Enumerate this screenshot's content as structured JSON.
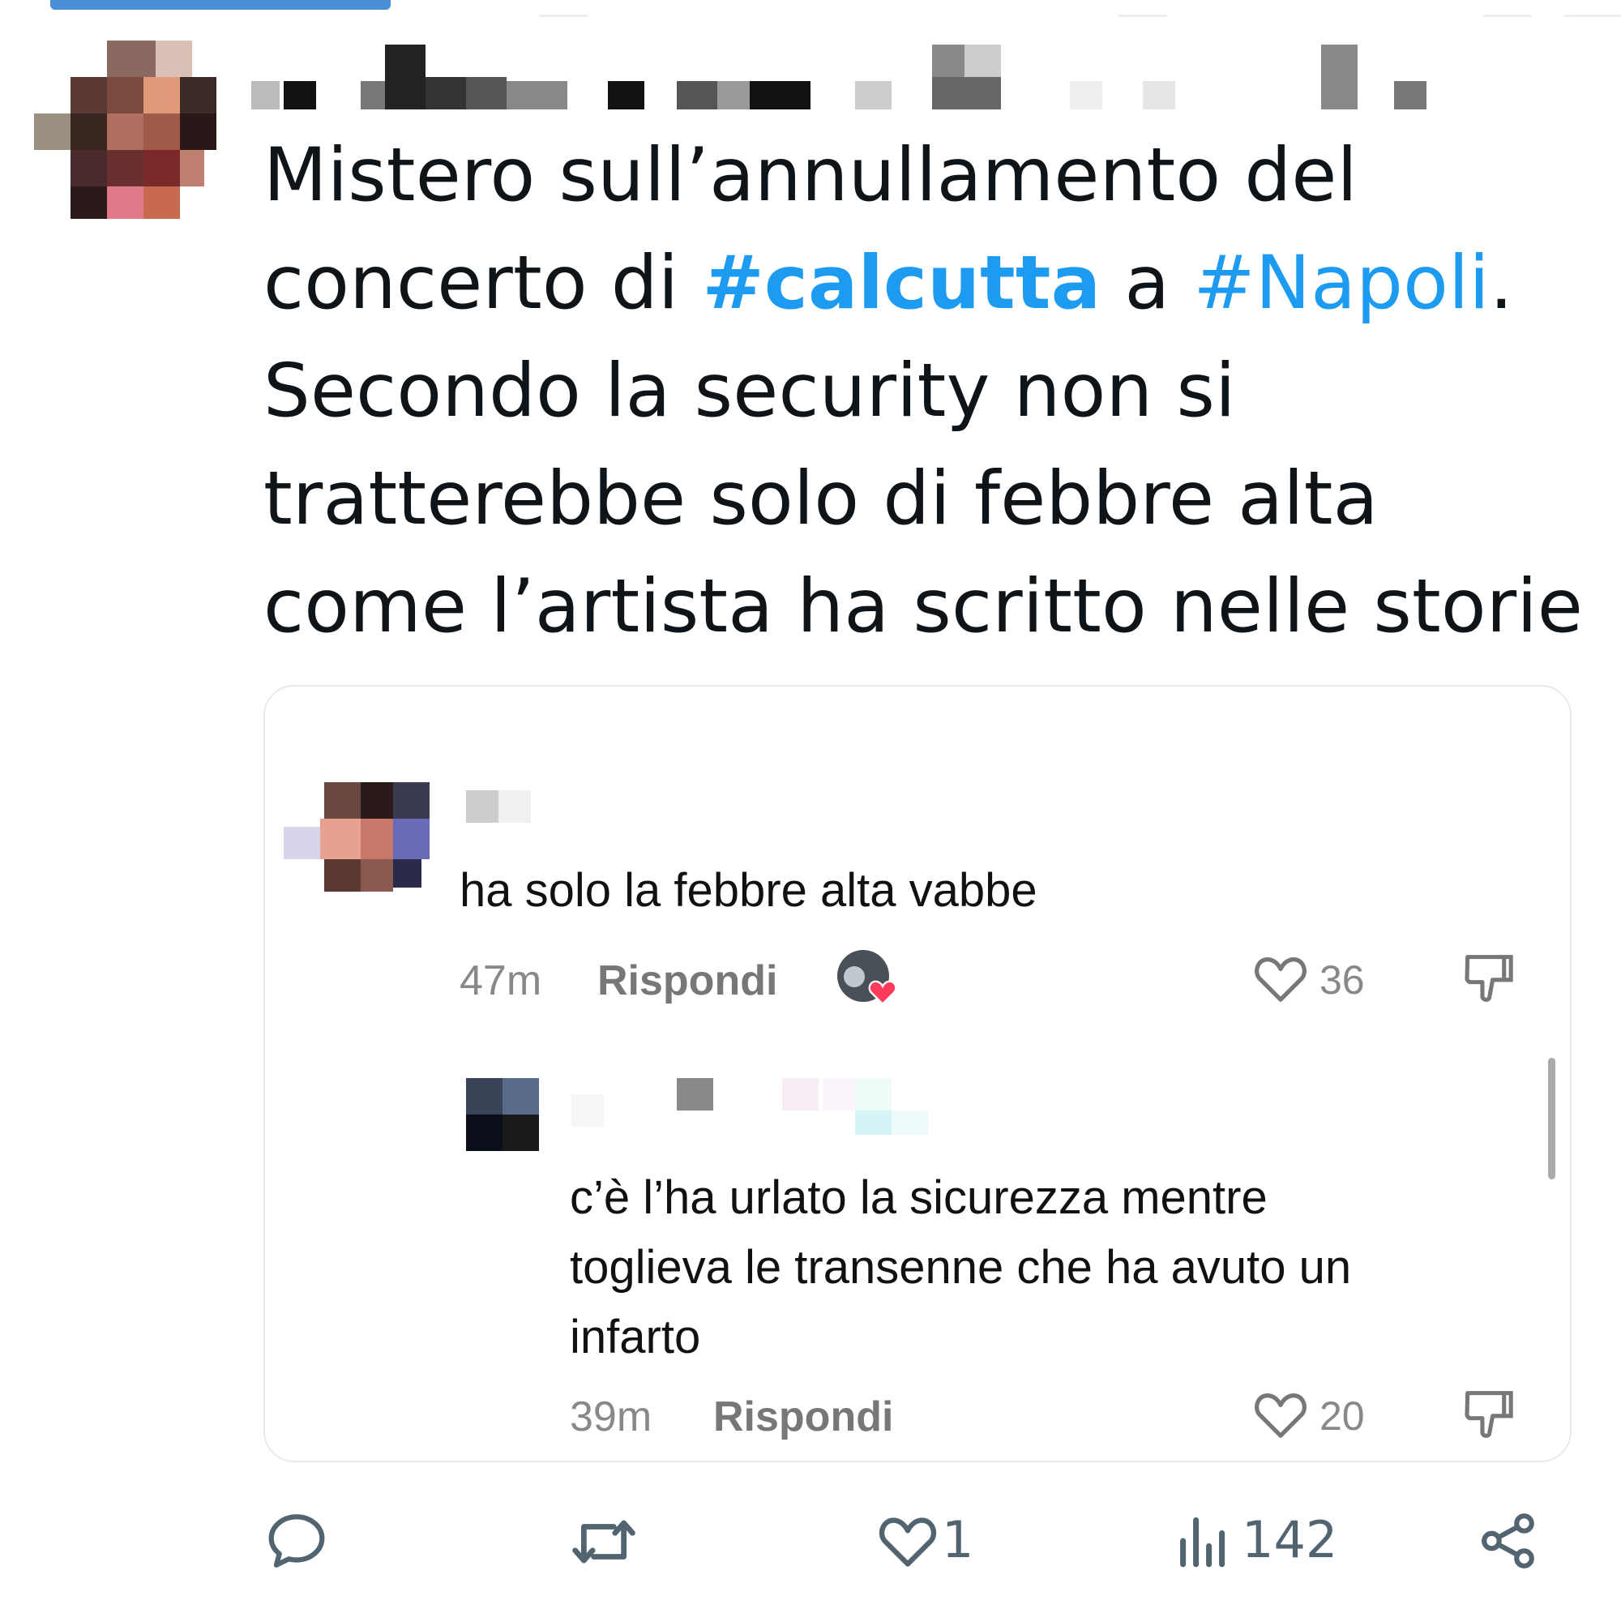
{
  "tweet": {
    "text_parts": {
      "p1": "Mistero sull’annullamento  del",
      "p2": "concerto di ",
      "hashtag1": "#calcutta",
      "p3": " a ",
      "hashtag2": "#Napoli",
      "p4": ".",
      "p5": "Secondo la security non si",
      "p6": "tratterebbe solo di febbre alta",
      "p7": "come l’artista ha scritto nelle storie"
    },
    "actions": {
      "replies": "",
      "retweets": "",
      "likes": "1",
      "views": "142"
    },
    "colors": {
      "hashtag": "#1d9bf0",
      "text": "#0f1419"
    }
  },
  "quote": {
    "comment1": {
      "text": "ha solo la febbre alta vabbe",
      "time": "47m",
      "reply_label": "Rispondi",
      "likes": "36"
    },
    "comment2": {
      "line1": "c’è l’ha urlato la sicurezza mentre",
      "line2": "toglieva le transenne che ha avuto un",
      "line3": "infarto",
      "time": "39m",
      "reply_label": "Rispondi",
      "likes": "20"
    }
  }
}
